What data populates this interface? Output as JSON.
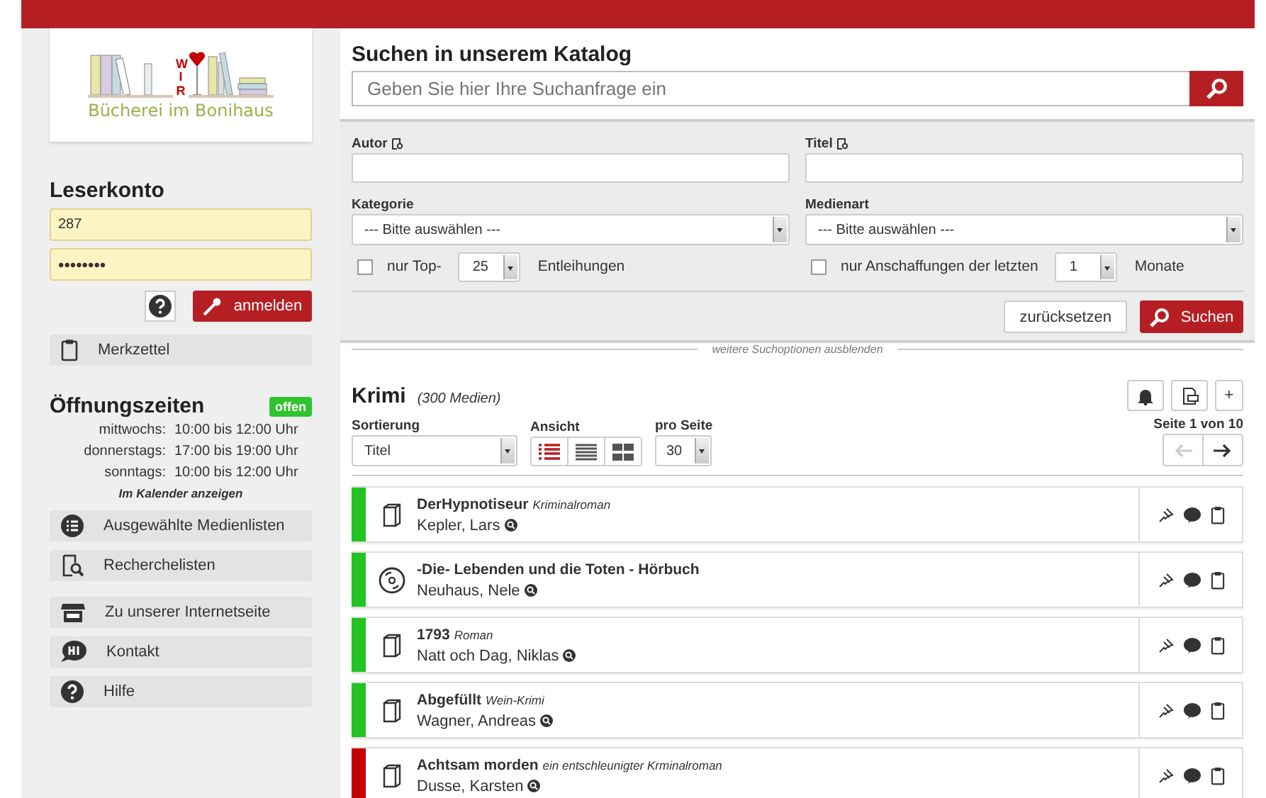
{
  "logo": {
    "letters": "WIR",
    "name": "Bücherei im Bonihaus"
  },
  "account": {
    "title": "Leserkonto",
    "user": "287",
    "password": "••••••••",
    "login_button": "anmelden"
  },
  "notepad": "Merkzettel",
  "hours": {
    "title": "Öffnungszeiten",
    "status": "offen",
    "entries": [
      {
        "day": "mittwochs:",
        "time": "10:00 bis 12:00 Uhr"
      },
      {
        "day": "donnerstags:",
        "time": "17:00 bis 19:00 Uhr"
      },
      {
        "day": "sonntags:",
        "time": "10:00 bis 12:00 Uhr"
      }
    ],
    "calendar_link": "Im Kalender anzeigen"
  },
  "links": [
    {
      "label": "Ausgewählte Medienlisten",
      "kind": "list"
    },
    {
      "label": "Recherchelisten",
      "kind": "research"
    },
    {
      "label": "Zu unserer Internetseite",
      "kind": "shop"
    },
    {
      "label": "Kontakt",
      "kind": "chat"
    },
    {
      "label": "Hilfe",
      "kind": "help"
    }
  ],
  "search": {
    "title": "Suchen in unserem Katalog",
    "placeholder": "Geben Sie hier Ihre Suchanfrage ein"
  },
  "advanced": {
    "author_label": "Autor",
    "title_label": "Titel",
    "category_label": "Kategorie",
    "category_value": "--- Bitte auswählen ---",
    "media_label": "Medienart",
    "media_value": "--- Bitte auswählen ---",
    "top": {
      "checked": false,
      "label": "nur Top-",
      "value": "25",
      "suffix": "Entleihungen"
    },
    "recent": {
      "checked": false,
      "label": "nur Anschaffungen der letzten",
      "value": "1",
      "suffix": "Monate"
    },
    "reset_button": "zurücksetzen",
    "search_button": "Suchen",
    "toggle": "weitere Suchoptionen ausblenden"
  },
  "results": {
    "title": "Krimi",
    "count": "(300 Medien)",
    "add_button": "+",
    "sort_label": "Sortierung",
    "sort_value": "Titel",
    "view_label": "Ansicht",
    "views": [
      {
        "kind": "list",
        "selected": true
      },
      {
        "kind": "compact",
        "selected": false
      },
      {
        "kind": "grid",
        "selected": false
      }
    ],
    "per_page_label": "pro Seite",
    "per_page_value": "30",
    "page_info": "Seite 1 von 10",
    "items": [
      {
        "title": "DerHypnotiseur",
        "subtitle": "Kriminalroman",
        "author": "Kepler, Lars",
        "kind": "book",
        "color": "#22c322"
      },
      {
        "title": "-Die- Lebenden und die Toten - Hörbuch",
        "author": "Neuhaus, Nele",
        "kind": "cd",
        "color": "#22c322"
      },
      {
        "title": "1793",
        "subtitle": "Roman",
        "author": "Natt och Dag, Niklas",
        "kind": "book",
        "color": "#22c322"
      },
      {
        "title": "Abgefüllt",
        "subtitle": "Wein-Krimi",
        "author": "Wagner, Andreas",
        "kind": "book",
        "color": "#22c322"
      },
      {
        "title": "Achtsam morden",
        "subtitle": "ein entschleunigter Krminalroman",
        "author": "Dusse, Karsten",
        "kind": "book",
        "color": "#c40000"
      }
    ]
  }
}
